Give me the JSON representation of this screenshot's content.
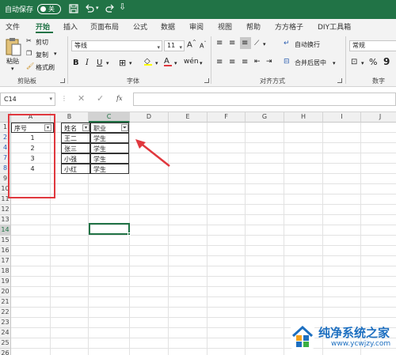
{
  "titlebar": {
    "autosave_label": "自动保存",
    "autosave_state": "关"
  },
  "tabs": [
    "文件",
    "开始",
    "插入",
    "页面布局",
    "公式",
    "数据",
    "审阅",
    "视图",
    "帮助",
    "方方格子",
    "DIY工具箱"
  ],
  "ribbon": {
    "paste": "粘贴",
    "cut": "剪切",
    "copy": "复制",
    "format_painter": "格式刷",
    "clipboard_group": "剪贴板",
    "font_name": "等线",
    "font_size": "11",
    "font_group": "字体",
    "wrap_text": "自动换行",
    "merge_center": "合并后居中",
    "align_group": "对齐方式",
    "number_format": "常规",
    "number_group": "数字",
    "bold": "B",
    "italic": "I",
    "underline": "U"
  },
  "formula_bar": {
    "name_box": "C14",
    "fx": "fx"
  },
  "columns": [
    "A",
    "B",
    "C",
    "D",
    "E",
    "F",
    "G",
    "H",
    "I",
    "J"
  ],
  "rows": [
    "1",
    "2",
    "4",
    "7",
    "8",
    "9",
    "10",
    "11",
    "12",
    "13",
    "14",
    "15",
    "16",
    "17",
    "18",
    "19",
    "20",
    "21",
    "22",
    "23",
    "24",
    "25",
    "26"
  ],
  "headers": {
    "a": "序号",
    "b": "姓名",
    "c": "职业"
  },
  "data": [
    {
      "a": "1",
      "b": "王二",
      "c": "学生"
    },
    {
      "a": "2",
      "b": "张三",
      "c": "学生"
    },
    {
      "a": "3",
      "b": "小强",
      "c": "学生"
    },
    {
      "a": "4",
      "b": "小红",
      "c": "学生"
    }
  ],
  "watermark": {
    "title": "纯净系统之家",
    "url": "www.ycwjzy.com"
  },
  "colors": {
    "accent": "#217346",
    "annotation": "#e0383e",
    "filtered_row": "#2a5db0"
  }
}
